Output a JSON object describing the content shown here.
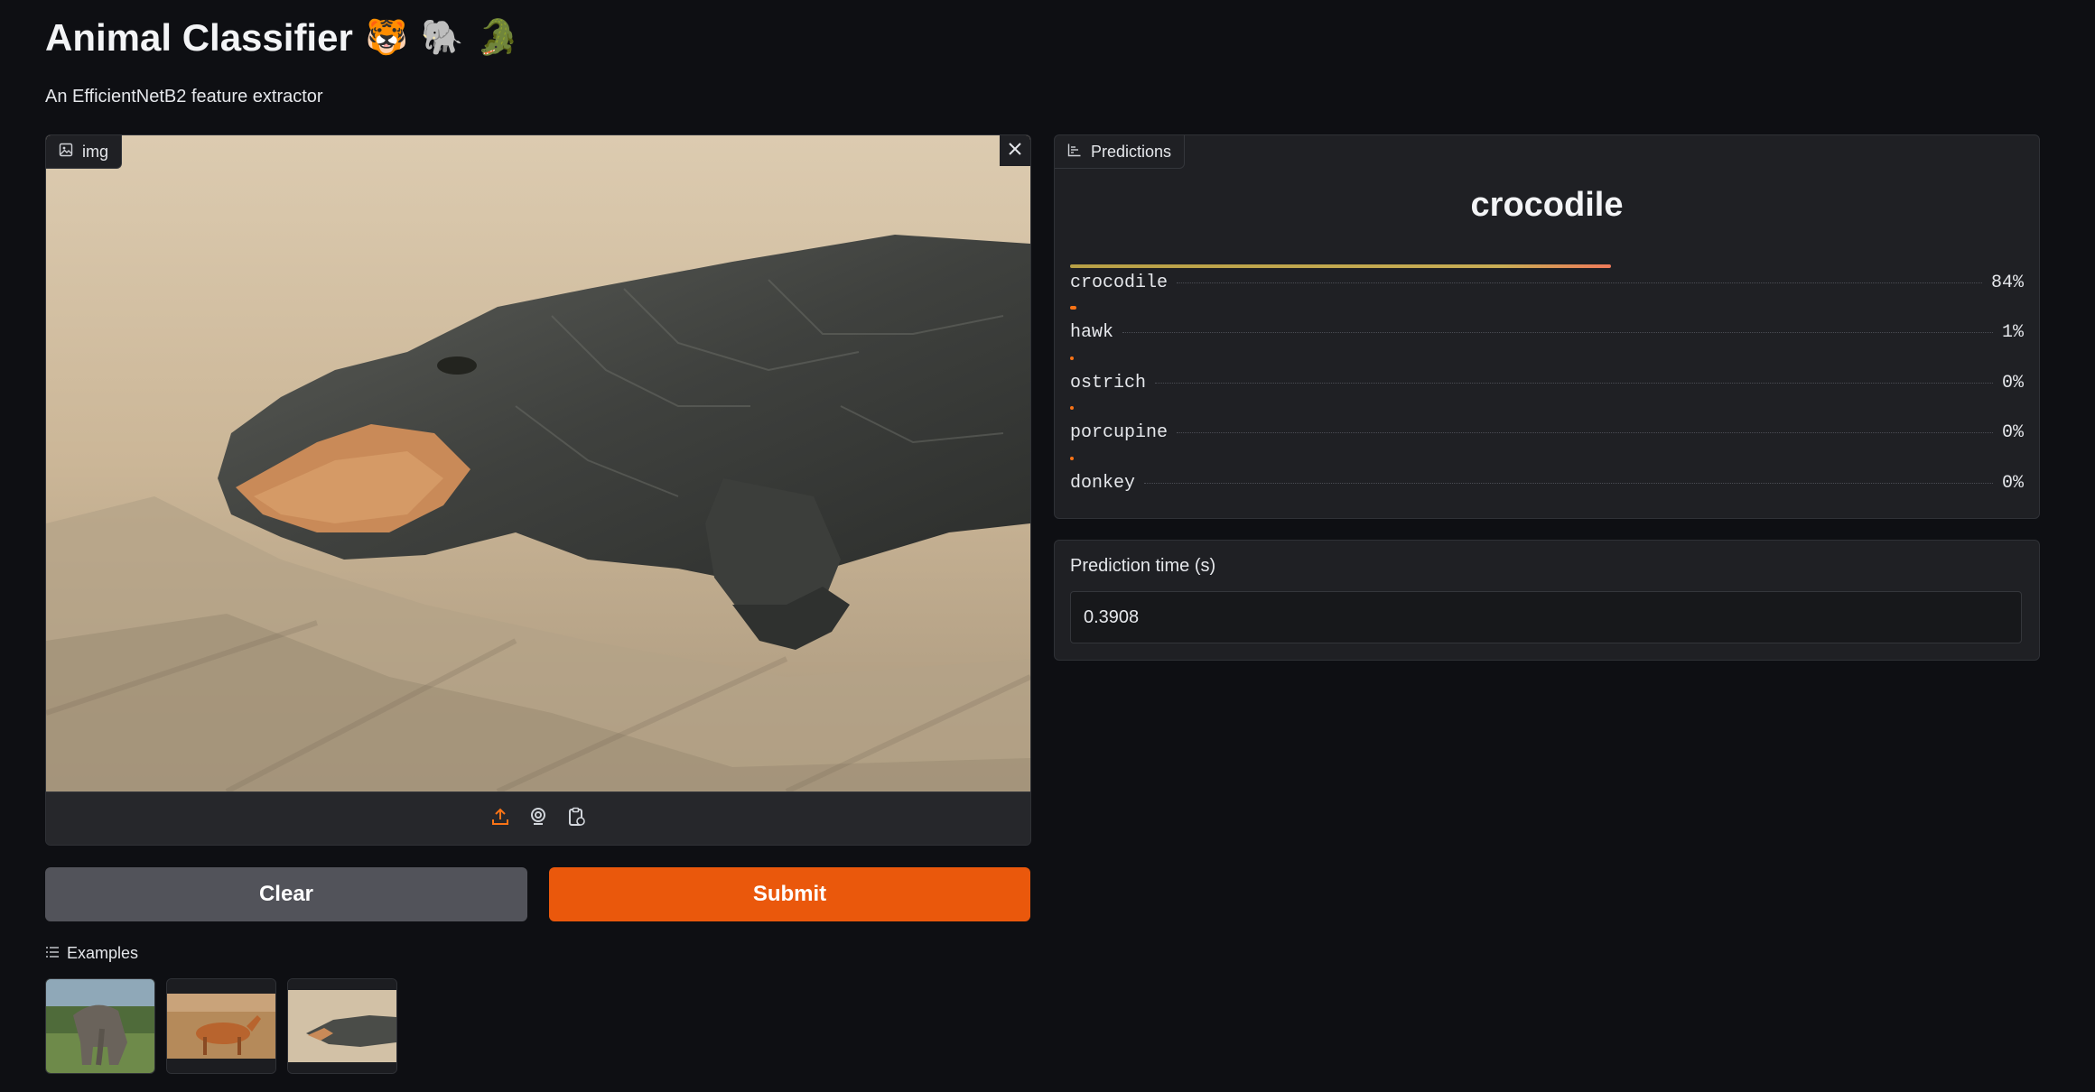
{
  "app": {
    "title": "Animal Classifier",
    "title_emojis": [
      "🐯",
      "🐘",
      "🐊"
    ],
    "subtitle": "An EfficientNetB2 feature extractor"
  },
  "input": {
    "label": "img",
    "icon": "image-icon",
    "tools": [
      "upload-icon",
      "webcam-icon",
      "clipboard-icon"
    ],
    "accent_color": "#f97316"
  },
  "buttons": {
    "clear": "Clear",
    "submit": "Submit"
  },
  "examples": {
    "label": "Examples",
    "items": [
      "elephant",
      "antelope",
      "crocodile"
    ]
  },
  "predictions": {
    "label": "Predictions",
    "top_label": "crocodile",
    "top_confidence": 0.84,
    "rows": [
      {
        "label": "crocodile",
        "percent": "84%",
        "value": 0.84
      },
      {
        "label": "hawk",
        "percent": "1%",
        "value": 0.01
      },
      {
        "label": "ostrich",
        "percent": "0%",
        "value": 0.0
      },
      {
        "label": "porcupine",
        "percent": "0%",
        "value": 0.0
      },
      {
        "label": "donkey",
        "percent": "0%",
        "value": 0.0
      }
    ]
  },
  "prediction_time": {
    "label": "Prediction time (s)",
    "value": "0.3908"
  }
}
